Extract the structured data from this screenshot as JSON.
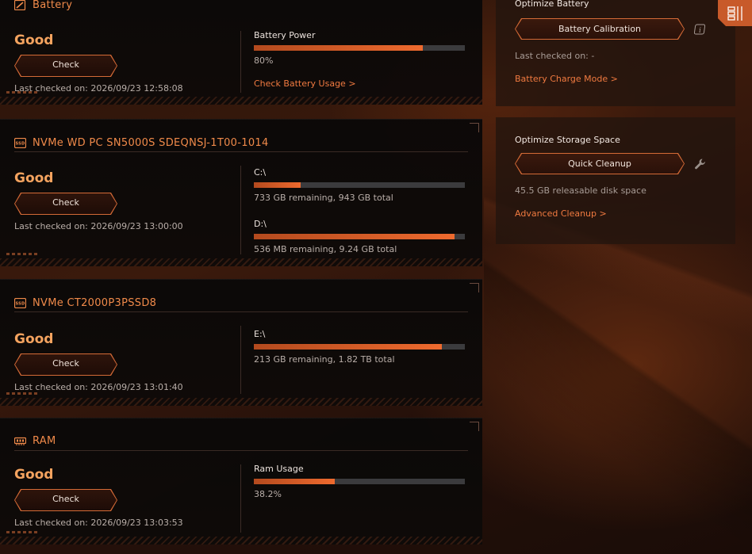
{
  "battery": {
    "header": "Battery",
    "status": "Good",
    "check_label": "Check",
    "last_checked": "Last checked on: 2026/09/23 12:58:08",
    "metric_label": "Battery Power",
    "metric_percent": 80,
    "metric_value": "80%",
    "usage_link": "Check Battery Usage >"
  },
  "ssd1": {
    "header": "NVMe WD PC SN5000S SDEQNSJ-1T00-1014",
    "status": "Good",
    "check_label": "Check",
    "last_checked": "Last checked on: 2026/09/23 13:00:00",
    "drives": [
      {
        "label": "C:\\",
        "fill_percent": 22,
        "info": "733 GB remaining, 943 GB total"
      },
      {
        "label": "D:\\",
        "fill_percent": 95,
        "info": "536 MB remaining, 9.24 GB total"
      }
    ]
  },
  "ssd2": {
    "header": "NVMe CT2000P3PSSD8",
    "status": "Good",
    "check_label": "Check",
    "last_checked": "Last checked on: 2026/09/23 13:01:40",
    "drives": [
      {
        "label": "E:\\",
        "fill_percent": 89,
        "info": "213 GB remaining, 1.82 TB total"
      }
    ]
  },
  "ram": {
    "header": "RAM",
    "status": "Good",
    "check_label": "Check",
    "last_checked": "Last checked on: 2026/09/23 13:03:53",
    "metric_label": "Ram Usage",
    "metric_percent": 38.2,
    "metric_value": "38.2%"
  },
  "optimize_battery": {
    "title": "Optimize Battery",
    "button": "Battery Calibration",
    "last_checked": "Last checked on: -",
    "link": "Battery Charge Mode >"
  },
  "optimize_storage": {
    "title": "Optimize Storage Space",
    "button": "Quick Cleanup",
    "info": "45.5 GB releasable disk space",
    "link": "Advanced Cleanup >"
  },
  "colors": {
    "accent": "#f07a40",
    "status_good": "#f4a35f",
    "bar_track": "#3b3b3d"
  },
  "icons": [
    "battery-icon",
    "ssd-icon",
    "ram-icon",
    "info-icon",
    "wrench-icon",
    "panel-toggle-icon"
  ]
}
